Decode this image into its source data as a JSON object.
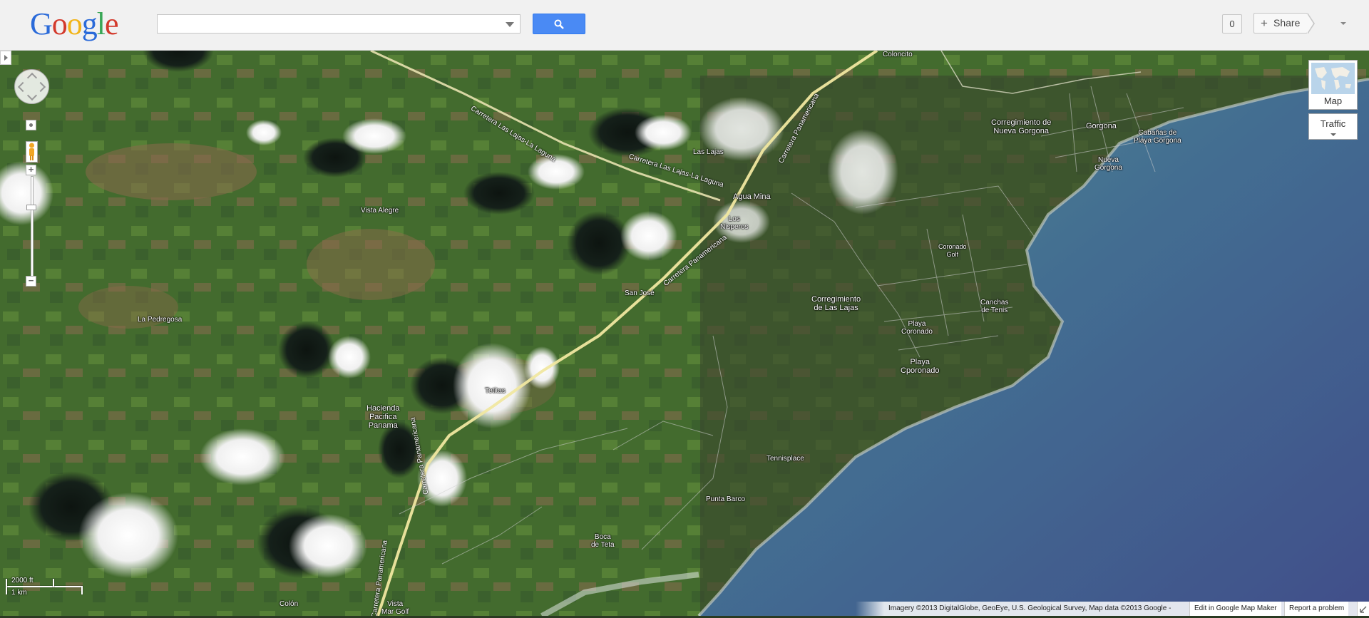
{
  "header": {
    "logo": [
      "G",
      "o",
      "o",
      "g",
      "l",
      "e"
    ],
    "search_value": "",
    "search_icon": "magnifier-icon",
    "count": "0",
    "share_label": "Share"
  },
  "map": {
    "map_type_label": "Map",
    "traffic_label": "Traffic",
    "scale_ft": "2000 ft",
    "scale_km": "1 km",
    "attribution": "Imagery ©2013 DigitalGlobe, GeoEye, U.S. Geological Survey, Map data ©2013 Google -",
    "edit_link": "Edit in Google Map Maker",
    "report_link": "Report a problem",
    "places": [
      {
        "id": "coloncito",
        "text": "Coloncito"
      },
      {
        "id": "las-lajas",
        "text": "Las Lajas"
      },
      {
        "id": "agua-mina",
        "text": "Agua Mina"
      },
      {
        "id": "los-nisperos",
        "text": "Los\nNisperos"
      },
      {
        "id": "vista-alegre",
        "text": "Vista Alegre"
      },
      {
        "id": "la-pedregosa",
        "text": "La Pedregosa"
      },
      {
        "id": "san-jose",
        "text": "San José"
      },
      {
        "id": "tetitas",
        "text": "Tetitas"
      },
      {
        "id": "hacienda",
        "text": "Hacienda\nPacifica\nPanama"
      },
      {
        "id": "corr-nueva-gorgona",
        "text": "Corregimiento de\nNueva Gorgona"
      },
      {
        "id": "gorgona",
        "text": "Gorgona"
      },
      {
        "id": "cabanas",
        "text": "Cabañas de\nPlaya Gorgona"
      },
      {
        "id": "nueva-gorgona",
        "text": "Nueva\nGorgona"
      },
      {
        "id": "coronado-golf",
        "text": "Coronado\nGolf"
      },
      {
        "id": "canchas",
        "text": "Canchas\nde Tenis"
      },
      {
        "id": "corr-las-lajas",
        "text": "Corregimiento\nde Las Lajas"
      },
      {
        "id": "playa-coronado",
        "text": "Playa\nCoronado"
      },
      {
        "id": "playa-cporonado",
        "text": "Playa\nCporonado"
      },
      {
        "id": "tennisplace",
        "text": "Tennisplace"
      },
      {
        "id": "punta-barco",
        "text": "Punta Barco"
      },
      {
        "id": "boca-de-teta",
        "text": "Boca\nde Teta"
      },
      {
        "id": "colon",
        "text": "Colón"
      },
      {
        "id": "vista-mar-golf",
        "text": "Vista\nMar Golf"
      }
    ],
    "roads": [
      {
        "id": "r-lajas-laguna-1",
        "text": "Carretera Las Lajas-La Laguna"
      },
      {
        "id": "r-lajas-laguna-2",
        "text": "Carretera Las Lajas-La Laguna"
      },
      {
        "id": "r-panam-1",
        "text": "Carretera Panamericana"
      },
      {
        "id": "r-panam-2",
        "text": "Carretera Panamericana"
      },
      {
        "id": "r-panam-3",
        "text": "Carretera Panamericana"
      },
      {
        "id": "r-panam-4",
        "text": "Carretera Panamericana"
      }
    ]
  }
}
